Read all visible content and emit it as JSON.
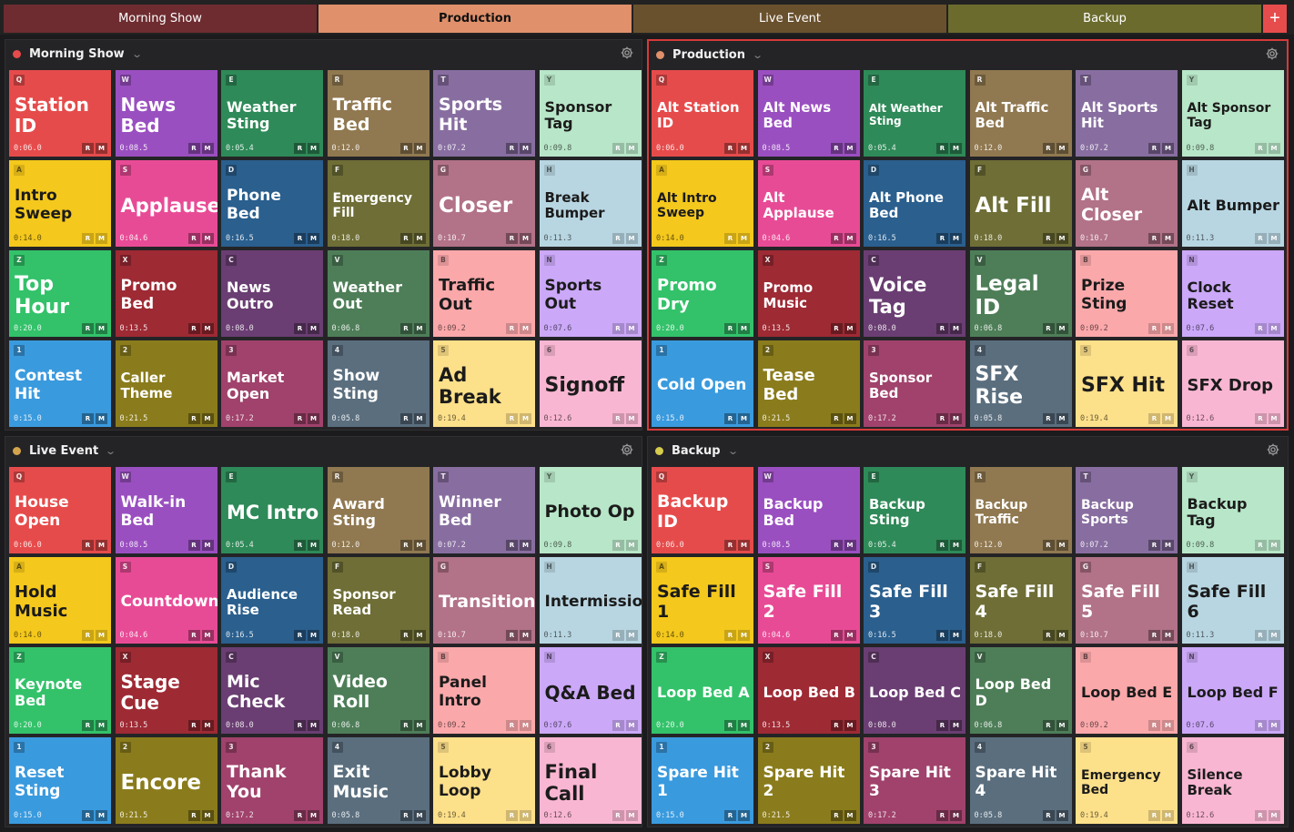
{
  "tabs": [
    {
      "label": "Morning Show",
      "color": "#6e2c30",
      "active": false
    },
    {
      "label": "Production",
      "color": "#e0906a",
      "active": true
    },
    {
      "label": "Live Event",
      "color": "#6a512e",
      "active": false
    },
    {
      "label": "Backup",
      "color": "#6b6b2e",
      "active": false
    }
  ],
  "add_tab_label": "+",
  "hotkeys": [
    "Q",
    "W",
    "E",
    "R",
    "T",
    "Y",
    "A",
    "S",
    "D",
    "F",
    "G",
    "H",
    "Z",
    "X",
    "C",
    "V",
    "B",
    "N",
    "1",
    "2",
    "3",
    "4",
    "5",
    "6"
  ],
  "colors": [
    "#e64b4b",
    "#9a4fc0",
    "#2e8a58",
    "#907850",
    "#886ea0",
    "#b8e6c8",
    "#f4c81c",
    "#e84b96",
    "#2a5f8e",
    "#6e6e36",
    "#b27288",
    "#b8d6e2",
    "#33c26a",
    "#9e2a34",
    "#6a3e72",
    "#4e7e58",
    "#fba8aa",
    "#cba8f8",
    "#3a9ade",
    "#8a7c1c",
    "#a0426c",
    "#5a6e7e",
    "#fde08a",
    "#f9b6d2"
  ],
  "light_cells": [
    5,
    6,
    11,
    16,
    17,
    22,
    23
  ],
  "durations": [
    "0:06.0",
    "0:08.5",
    "0:05.4",
    "0:12.0",
    "0:07.2",
    "0:09.8",
    "0:14.0",
    "0:04.6",
    "0:16.5",
    "0:18.0",
    "0:10.7",
    "0:11.3",
    "0:20.0",
    "0:13.5",
    "0:08.0",
    "0:06.8",
    "0:09.2",
    "0:07.6",
    "0:15.0",
    "0:21.5",
    "0:17.2",
    "0:05.8",
    "0:19.4",
    "0:12.6"
  ],
  "rm_labels": {
    "r": "R",
    "m": "M"
  },
  "panels": [
    {
      "title": "Morning Show",
      "dot": "#e64b4b",
      "selected": false,
      "labels": [
        "Station ID",
        "News Bed",
        "Weather Sting",
        "Traffic Bed",
        "Sports Hit",
        "Sponsor Tag",
        "Intro Sweep",
        "Applause",
        "Phone Bed",
        "Emergency Fill",
        "Closer",
        "Break Bumper",
        "Top Hour",
        "Promo Bed",
        "News Outro",
        "Weather Out",
        "Traffic Out",
        "Sports Out",
        "Contest Hit",
        "Caller Theme",
        "Market Open",
        "Show Sting",
        "Ad Break",
        "Signoff"
      ],
      "sizes": [
        20,
        20,
        16,
        19,
        19,
        16,
        17,
        21,
        17,
        14,
        23,
        15,
        22,
        17,
        16,
        16,
        18,
        17,
        17,
        15,
        16,
        17,
        21,
        22
      ]
    },
    {
      "title": "Production",
      "dot": "#e0906a",
      "selected": true,
      "labels": [
        "Alt Station ID",
        "Alt News Bed",
        "Alt Weather Sting",
        "Alt Traffic Bed",
        "Alt Sports Hit",
        "Alt Sponsor Tag",
        "Alt Intro Sweep",
        "Alt Applause",
        "Alt Phone Bed",
        "Alt Fill",
        "Alt Closer",
        "Alt Bumper",
        "Promo Dry",
        "Promo Music",
        "Voice Tag",
        "Legal ID",
        "Prize Sting",
        "Clock Reset",
        "Cold Open",
        "Tease Bed",
        "Sponsor Bed",
        "SFX Rise",
        "SFX Hit",
        "SFX Drop"
      ],
      "sizes": [
        15,
        15,
        12,
        15,
        15,
        14,
        14,
        15,
        15,
        23,
        19,
        16,
        18,
        15,
        21,
        23,
        17,
        16,
        17,
        18,
        15,
        22,
        22,
        18
      ]
    },
    {
      "title": "Live Event",
      "dot": "#d4a44c",
      "selected": false,
      "labels": [
        "House Open",
        "Walk-in Bed",
        "MC Intro",
        "Award Sting",
        "Winner Bed",
        "Photo Op",
        "Hold Music",
        "Countdown",
        "Audience Rise",
        "Sponsor Read",
        "Transition",
        "Intermission",
        "Keynote Bed",
        "Stage Cue",
        "Mic Check",
        "Video Roll",
        "Panel Intro",
        "Q&A Bed",
        "Reset Sting",
        "Encore",
        "Thank You",
        "Exit Music",
        "Lobby Loop",
        "Final Call"
      ],
      "sizes": [
        17,
        17,
        21,
        16,
        17,
        19,
        18,
        17,
        15,
        15,
        19,
        17,
        16,
        20,
        19,
        19,
        17,
        20,
        17,
        23,
        19,
        19,
        17,
        21
      ]
    },
    {
      "title": "Backup",
      "dot": "#d8cc4c",
      "selected": false,
      "labels": [
        "Backup ID",
        "Backup Bed",
        "Backup Sting",
        "Backup Traffic",
        "Backup Sports",
        "Backup Tag",
        "Safe Fill 1",
        "Safe Fill 2",
        "Safe Fill 3",
        "Safe Fill 4",
        "Safe Fill 5",
        "Safe Fill 6",
        "Loop Bed A",
        "Loop Bed B",
        "Loop Bed C",
        "Loop Bed D",
        "Loop Bed E",
        "Loop Bed F",
        "Spare Hit 1",
        "Spare Hit 2",
        "Spare Hit 3",
        "Spare Hit 4",
        "Emergency Bed",
        "Silence Break"
      ],
      "sizes": [
        19,
        16,
        15,
        14,
        14,
        16,
        19,
        19,
        19,
        19,
        19,
        19,
        16,
        16,
        16,
        16,
        16,
        16,
        17,
        17,
        17,
        17,
        14,
        15
      ]
    }
  ]
}
